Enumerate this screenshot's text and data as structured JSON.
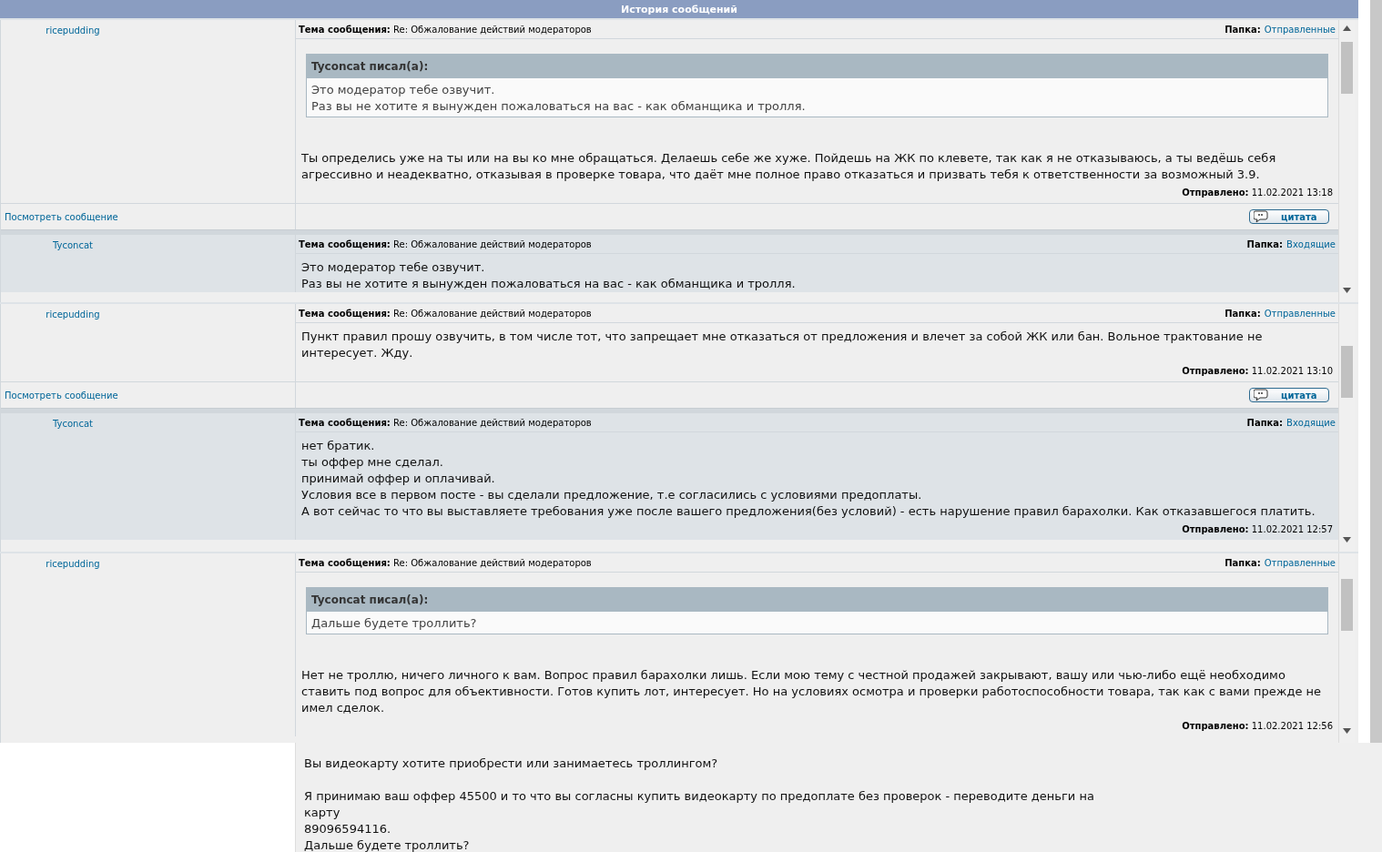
{
  "header": {
    "title": "История сообщений"
  },
  "panes": [
    {
      "messages": [
        {
          "kind": "sent",
          "author": "ricepudding",
          "subject_label": "Тема сообщения:",
          "subject": "Re: Обжалование действий модераторов",
          "folder_label": "Папка:",
          "folder": "Отправленные",
          "quote": {
            "author_line": "Tyconcat писал(а):",
            "lines": [
              "Это модератор тебе озвучит.",
              "Раз вы не хотите я вынужден пожаловаться на вас - как обманщика и тролля."
            ]
          },
          "body": [
            "Ты определись уже на ты или на вы ко мне обращаться. Делаешь себе же хуже. Пойдешь на ЖК по клевете, так как я не отказываюсь, а ты ведёшь себя агрессивно и неадекватно, отказывая в проверке товара, что даёт мне полное право отказаться и призвать тебя к ответственности за возможный 3.9."
          ],
          "sent_label": "Отправлено:",
          "sent": "11.02.2021 13:18",
          "view_link": "Посмотреть сообщение",
          "quote_button": "цитата"
        },
        {
          "kind": "inbox",
          "author": "Tyconcat",
          "subject_label": "Тема сообщения:",
          "subject": "Re: Обжалование действий модераторов",
          "folder_label": "Папка:",
          "folder": "Входящие",
          "body": [
            "Это модератор тебе озвучит.",
            "Раз вы не хотите я вынужден пожаловаться на вас - как обманщика и тролля."
          ]
        }
      ]
    },
    {
      "messages": [
        {
          "kind": "sent",
          "author": "ricepudding",
          "subject_label": "Тема сообщения:",
          "subject": "Re: Обжалование действий модераторов",
          "folder_label": "Папка:",
          "folder": "Отправленные",
          "body": [
            "Пункт правил прошу озвучить, в том числе тот, что запрещает мне отказаться от предложения и влечет за собой ЖК или бан. Вольное трактование не интересует. Жду."
          ],
          "sent_label": "Отправлено:",
          "sent": "11.02.2021 13:10",
          "view_link": "Посмотреть сообщение",
          "quote_button": "цитата"
        },
        {
          "kind": "inbox",
          "author": "Tyconcat",
          "subject_label": "Тема сообщения:",
          "subject": "Re: Обжалование действий модераторов",
          "folder_label": "Папка:",
          "folder": "Входящие",
          "body": [
            "нет братик.",
            "ты оффер мне сделал.",
            "принимай оффер и оплачивай.",
            "Условия все в первом посте - вы сделали предложение, т.е согласились с условиями предоплаты.",
            "А вот сейчас то что вы выставляете требования уже после вашего предложения(без условий) - есть нарушение правил барахолки. Как отказавшегося платить."
          ],
          "sent_label": "Отправлено:",
          "sent": "11.02.2021 12:57"
        }
      ]
    },
    {
      "messages": [
        {
          "kind": "sent",
          "author": "ricepudding",
          "subject_label": "Тема сообщения:",
          "subject": "Re: Обжалование действий модераторов",
          "folder_label": "Папка:",
          "folder": "Отправленные",
          "quote": {
            "author_line": "Tyconcat писал(а):",
            "lines": [
              "Дальше будете троллить?"
            ]
          },
          "body": [
            "Нет не троллю, ничего личного к вам. Вопрос правил барахолки лишь. Если мою тему с честной продажей закрывают, вашу или чью-либо ещё необходимо ставить под вопрос для объективности. Готов купить лот, интересует. Но на условиях осмотра и проверки работоспособности товара, так как с вами прежде не имел сделок."
          ],
          "sent_label": "Отправлено:",
          "sent": "11.02.2021 12:56"
        }
      ]
    }
  ],
  "bottom_message": {
    "paragraphs": [
      [
        "Вы видеокарту хотите приобрести или занимаетесь троллингом?"
      ],
      [
        "Я принимаю ваш оффер 45500 и то что вы согласны купить видеокарту по предоплате без проверок - переводите деньги на карту",
        "89096594116.",
        "Дальше будете троллить?"
      ]
    ]
  }
}
